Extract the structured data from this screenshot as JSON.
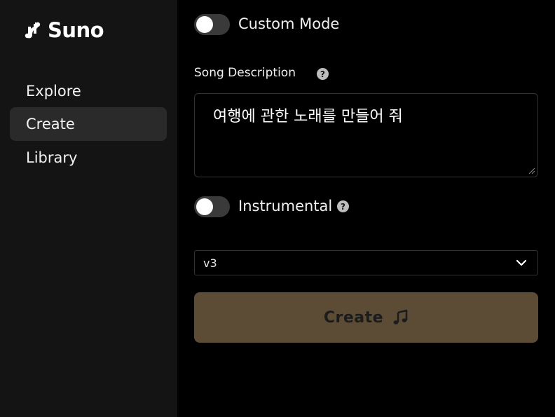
{
  "app": {
    "brand": "Suno"
  },
  "sidebar": {
    "items": [
      {
        "label": "Explore",
        "active": false
      },
      {
        "label": "Create",
        "active": true
      },
      {
        "label": "Library",
        "active": false
      }
    ]
  },
  "form": {
    "custom_mode": {
      "label": "Custom Mode",
      "enabled": false
    },
    "song_description": {
      "label": "Song Description",
      "help_icon": "question-circle-icon",
      "value": "여행에 관한 노래를 만들어 줘"
    },
    "instrumental": {
      "label": "Instrumental",
      "enabled": false,
      "help_icon": "question-circle-icon"
    },
    "model_select": {
      "selected": "v3"
    },
    "create_button": {
      "label": "Create",
      "icon": "music-note-icon"
    }
  },
  "colors": {
    "sidebar_bg": "#141414",
    "main_bg": "#000000",
    "active_nav_bg": "#2a2a2a",
    "create_button_bg": "#5d4c35",
    "toggle_track": "#3a3a3a"
  }
}
